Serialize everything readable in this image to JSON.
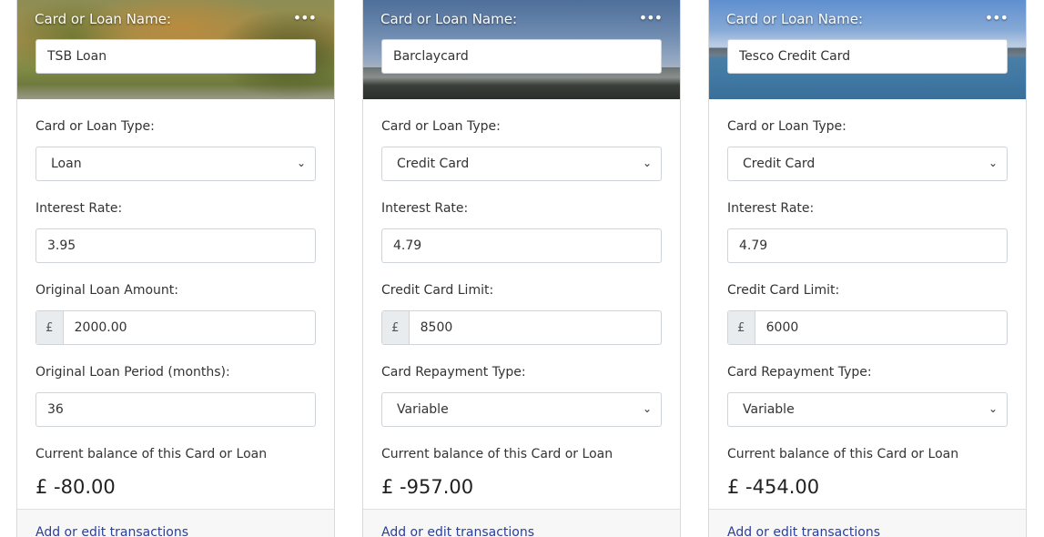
{
  "common": {
    "name_label": "Card or Loan Name:",
    "type_label": "Card or Loan Type:",
    "interest_label": "Interest Rate:",
    "balance_label": "Current balance of this Card or Loan",
    "currency_symbol": "£",
    "footer_link": "Add or edit transactions",
    "menu_icon": "ellipsis-icon"
  },
  "cards": [
    {
      "name": "TSB Loan",
      "type": "Loan",
      "interest_rate": "3.95",
      "field3_label": "Original Loan Amount:",
      "field3_value": "2000.00",
      "field4_label": "Original Loan Period (months):",
      "field4_value": "36",
      "balance": "£ -80.00"
    },
    {
      "name": "Barclaycard",
      "type": "Credit Card",
      "interest_rate": "4.79",
      "field3_label": "Credit Card Limit:",
      "field3_value": "8500",
      "field4_label": "Card Repayment Type:",
      "field4_value": "Variable",
      "balance": "£ -957.00"
    },
    {
      "name": "Tesco Credit Card",
      "type": "Credit Card",
      "interest_rate": "4.79",
      "field3_label": "Credit Card Limit:",
      "field3_value": "6000",
      "field4_label": "Card Repayment Type:",
      "field4_value": "Variable",
      "balance": "£ -454.00"
    }
  ]
}
